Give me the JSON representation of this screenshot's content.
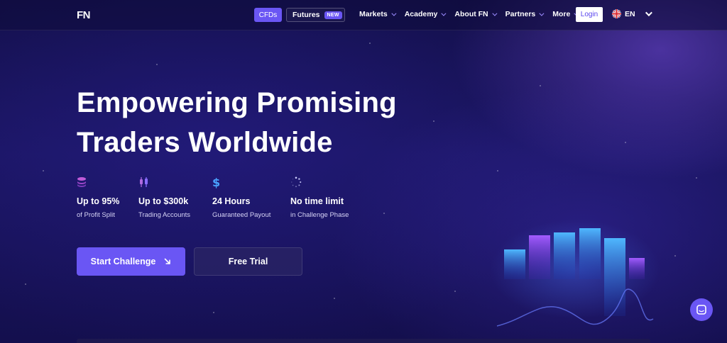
{
  "nav": {
    "logo": "FN",
    "cfds_label": "CFDs",
    "futures_label": "Futures",
    "futures_badge": "NEW",
    "menu": [
      "Markets",
      "Academy",
      "About FN",
      "Partners",
      "More"
    ],
    "login_label": "Login",
    "language": "EN"
  },
  "hero": {
    "title_line1": "Empowering Promising",
    "title_line2": "Traders Worldwide",
    "features": [
      {
        "icon": "coins-stack-icon",
        "value": "Up to 95%",
        "sub": "of Profit Split"
      },
      {
        "icon": "candlestick-icon",
        "value": "Up to $300k",
        "sub": "Trading Accounts"
      },
      {
        "icon": "dollar-icon",
        "value": "24 Hours",
        "sub": "Guaranteed Payout"
      },
      {
        "icon": "spinner-icon",
        "value": "No time limit",
        "sub": "in Challenge Phase"
      }
    ],
    "start_label": "Start Challenge",
    "trial_label": "Free Trial"
  },
  "colors": {
    "accent": "#6a56f4",
    "background": "#140f4e",
    "feature_icon": "#8a6cff",
    "dollar_icon": "#4aa3ff"
  }
}
